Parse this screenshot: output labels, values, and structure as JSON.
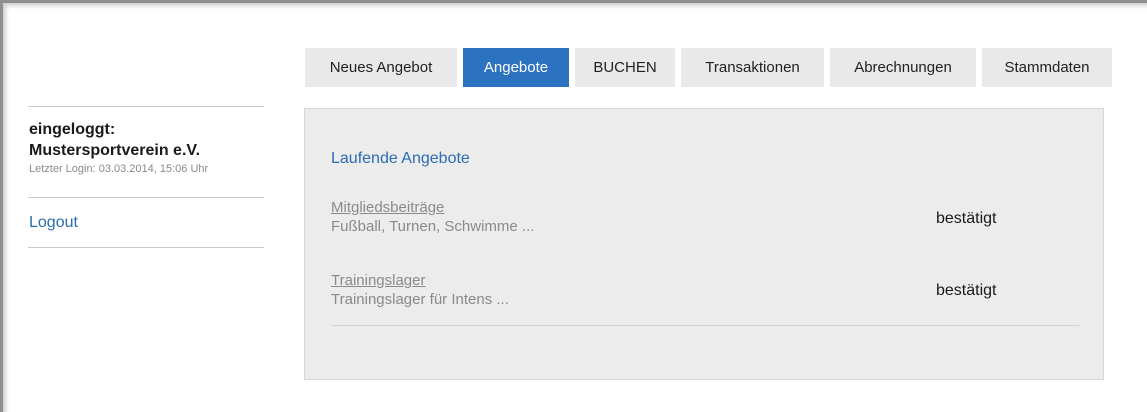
{
  "nav": {
    "items": [
      {
        "label": "Neues Angebot"
      },
      {
        "label": "Angebote"
      },
      {
        "label": "BUCHEN"
      },
      {
        "label": "Transaktionen"
      },
      {
        "label": "Abrechnungen"
      },
      {
        "label": "Stammdaten"
      }
    ],
    "active": "Angebote"
  },
  "sidebar": {
    "user_label": "eingeloggt:",
    "club_name": "Mustersportverein e.V.",
    "last_login": "Letzter Login: 03.03.2014, 15:06 Uhr",
    "logout": "Logout"
  },
  "main": {
    "section_title": "Laufende Angebote",
    "offers": [
      {
        "name": "Mitgliedsbeiträge",
        "description": "Fußball, Turnen, Schwimme ...",
        "status": "bestätigt"
      },
      {
        "name": "Trainingslager",
        "description": "Trainingslager für Intens ...",
        "status": "bestätigt"
      }
    ]
  },
  "colors": {
    "accent": "#2b73c1",
    "link": "#2b6cb3",
    "nav_bg": "#e9e9e9",
    "panel_bg": "#ececec"
  }
}
